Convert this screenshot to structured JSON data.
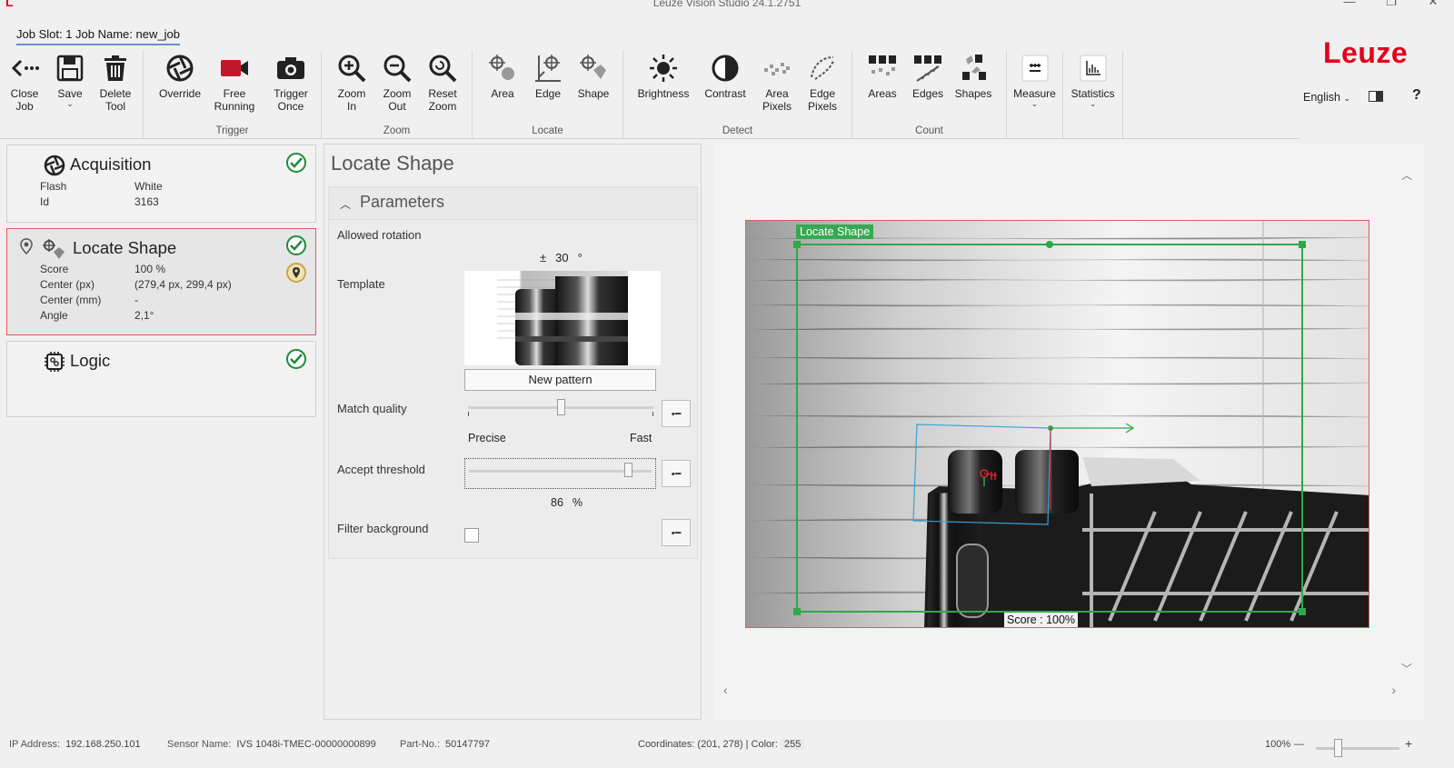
{
  "window": {
    "title": "Leuze Vision Studio 24.1.2751"
  },
  "header": {
    "job_slot": "Job Slot: 1 Job Name: new_job",
    "brand": "Leuze",
    "language": "English",
    "help": "?"
  },
  "ribbon": {
    "groups": [
      {
        "label": "",
        "buttons": [
          {
            "label": "Close\nJob",
            "icon": "close-job-icon"
          },
          {
            "label": "Save",
            "icon": "save-icon",
            "dropdown": true
          },
          {
            "label": "Delete\nTool",
            "icon": "delete-icon"
          }
        ]
      },
      {
        "label": "Trigger",
        "buttons": [
          {
            "label": "Override",
            "icon": "override-icon"
          },
          {
            "label": "Free\nRunning",
            "icon": "camera-icon"
          },
          {
            "label": "Trigger\nOnce",
            "icon": "trigger-camera-icon"
          }
        ]
      },
      {
        "label": "Zoom",
        "buttons": [
          {
            "label": "Zoom\nIn",
            "icon": "zoom-in-icon"
          },
          {
            "label": "Zoom\nOut",
            "icon": "zoom-out-icon"
          },
          {
            "label": "Reset\nZoom",
            "icon": "zoom-reset-icon"
          }
        ]
      },
      {
        "label": "Locate",
        "buttons": [
          {
            "label": "Area",
            "icon": "locate-area-icon"
          },
          {
            "label": "Edge",
            "icon": "locate-edge-icon"
          },
          {
            "label": "Shape",
            "icon": "locate-shape-icon"
          }
        ]
      },
      {
        "label": "Detect",
        "buttons": [
          {
            "label": "Brightness",
            "icon": "brightness-icon"
          },
          {
            "label": "Contrast",
            "icon": "contrast-icon"
          },
          {
            "label": "Area\nPixels",
            "icon": "area-pixels-icon"
          },
          {
            "label": "Edge\nPixels",
            "icon": "edge-pixels-icon"
          }
        ]
      },
      {
        "label": "Count",
        "buttons": [
          {
            "label": "Areas",
            "icon": "count-areas-icon"
          },
          {
            "label": "Edges",
            "icon": "count-edges-icon"
          },
          {
            "label": "Shapes",
            "icon": "count-shapes-icon"
          }
        ]
      },
      {
        "label": "",
        "buttons": [
          {
            "label": "Measure",
            "icon": "measure-icon",
            "dropdown": true
          }
        ]
      },
      {
        "label": "",
        "buttons": [
          {
            "label": "Statistics",
            "icon": "statistics-icon",
            "dropdown": true
          }
        ]
      }
    ]
  },
  "tools": {
    "acquisition": {
      "title": "Acquisition",
      "rows": [
        {
          "k": "Flash",
          "v": "White"
        },
        {
          "k": "Id",
          "v": "3163"
        }
      ]
    },
    "locate_shape": {
      "title": "Locate Shape",
      "rows": [
        {
          "k": "Score",
          "v": "100 %"
        },
        {
          "k": "Center (px)",
          "v": "(279,4 px, 299,4 px)"
        },
        {
          "k": "Center (mm)",
          "v": "-"
        },
        {
          "k": "Angle",
          "v": "2,1°"
        }
      ]
    },
    "logic": {
      "title": "Logic"
    }
  },
  "editor": {
    "title": "Locate Shape",
    "section": "Parameters",
    "allowed_rotation": {
      "label": "Allowed rotation",
      "prefix": "±",
      "value": "30",
      "unit": "°"
    },
    "template": {
      "label": "Template",
      "button": "New pattern"
    },
    "match_quality": {
      "label": "Match quality",
      "min_label": "Precise",
      "max_label": "Fast",
      "level": 0.5
    },
    "accept_threshold": {
      "label": "Accept threshold",
      "value": "86",
      "unit": "%",
      "level": 0.86
    },
    "filter_background": {
      "label": "Filter background",
      "checked": false
    }
  },
  "viewer": {
    "roi_label": "Locate Shape",
    "score_label": "Score : 100%"
  },
  "status": {
    "ip_label": "IP Address:",
    "ip": "192.168.250.101",
    "sensor_label": "Sensor Name:",
    "sensor": "IVS 1048i-TMEC-00000000899",
    "part_label": "Part-No.:",
    "part": "50147797",
    "coords": "Coordinates: (201, 278) | Color:",
    "color_value": "255",
    "zoom": "100%",
    "zoom_minus": "—",
    "zoom_plus": "+"
  }
}
